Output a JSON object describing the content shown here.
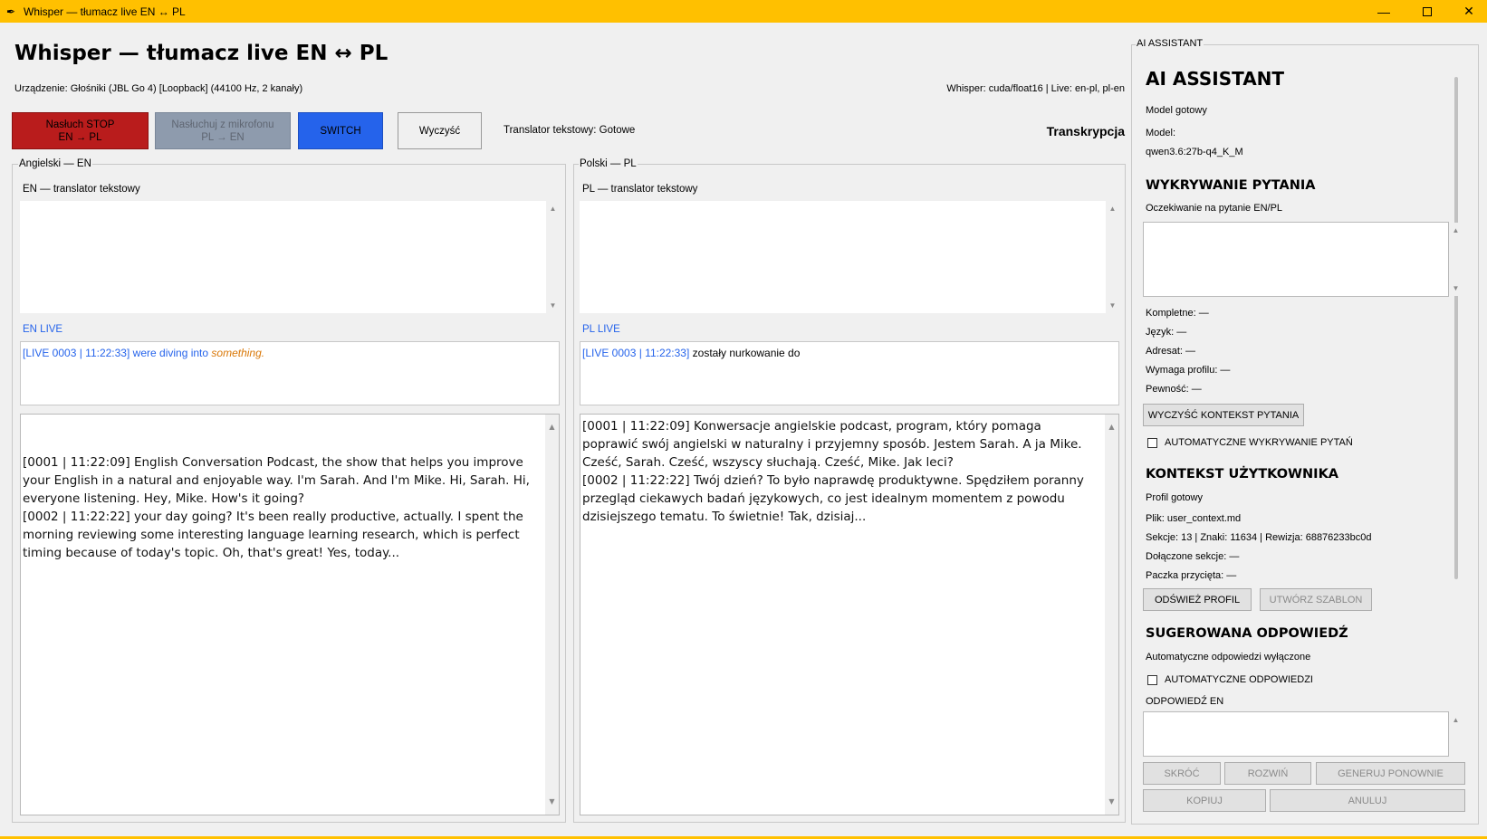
{
  "window": {
    "icon": "feather-icon",
    "title": "Whisper — tłumacz live EN ↔ PL",
    "controls": {
      "minimize": "—",
      "maximize": "",
      "close": "✕"
    }
  },
  "header": {
    "title": "Whisper — tłumacz live EN ↔ PL",
    "device": "Urządzenie: Głośniki (JBL Go 4) [Loopback] (44100 Hz, 2 kanały)",
    "whisper_info": "Whisper: cuda/float16 | Live: en-pl, pl-en"
  },
  "toolbar": {
    "stop_line1": "Nasłuch STOP",
    "stop_line2": "EN → PL",
    "mic_line1": "Nasłuchuj z mikrofonu",
    "mic_line2": "PL → EN",
    "switch": "SWITCH",
    "clear": "Wyczyść",
    "translator_status": "Translator tekstowy: Gotowe",
    "transcription_label": "Transkrypcja"
  },
  "colors": {
    "titlebar": "#ffc000",
    "stop": "#b91c1c",
    "mic_disabled": "#8e9bad",
    "switch": "#2563eb",
    "live_label": "#2563eb",
    "pending_word": "#d97706"
  },
  "english": {
    "group_label": "Angielski — EN",
    "translator_label": "EN — translator tekstowy",
    "translator_value": "",
    "live_label": "EN LIVE",
    "live_ts": "[LIVE 0003 | 11:22:33]",
    "live_text": "were diving into",
    "live_pending": "something.",
    "transcript": "[0001 | 11:22:09] English Conversation Podcast, the show that helps you improve your English in a natural and enjoyable way. I'm Sarah. And I'm Mike. Hi, Sarah. Hi, everyone listening. Hey, Mike. How's it going?\n[0002 | 11:22:22] your day going? It's been really productive, actually. I spent the morning reviewing some interesting language learning research, which is perfect timing because of today's topic. Oh, that's great! Yes, today..."
  },
  "polish": {
    "group_label": "Polski — PL",
    "translator_label": "PL — translator tekstowy",
    "translator_value": "",
    "live_label": "PL LIVE",
    "live_ts": "[LIVE 0003 | 11:22:33]",
    "live_text": "zostały nurkowanie do",
    "transcript": "[0001 | 11:22:09] Konwersacje angielskie podcast, program, który pomaga poprawić swój angielski w naturalny i przyjemny sposób. Jestem Sarah. A ja Mike. Cześć, Sarah. Cześć, wszyscy słuchają. Cześć, Mike. Jak leci?\n[0002 | 11:22:22] Twój dzień? To było naprawdę produktywne. Spędziłem poranny przegląd ciekawych badań językowych, co jest idealnym momentem z powodu dzisiejszego tematu. To świetnie! Tak, dzisiaj..."
  },
  "ai": {
    "frame_label": "AI ASSISTANT",
    "title": "AI ASSISTANT",
    "model_status": "Model gotowy",
    "model_label": "Model:",
    "model_name": "qwen3.6:27b-q4_K_M",
    "question_heading": "WYKRYWANIE PYTANIA",
    "question_status": "Oczekiwanie na pytanie EN/PL",
    "question_value": "",
    "complete": "Kompletne: —",
    "language": "Język: —",
    "addressee": "Adresat: —",
    "needs_profile": "Wymaga profilu: —",
    "confidence": "Pewność: —",
    "clear_context_button": "WYCZYŚĆ KONTEKST PYTANIA",
    "auto_detect_label": "AUTOMATYCZNE WYKRYWANIE PYTAŃ",
    "auto_detect_checked": false,
    "context_heading": "KONTEKST UŻYTKOWNIKA",
    "profile_status": "Profil gotowy",
    "file": "Plik: user_context.md",
    "stats": "Sekcje: 13 | Znaki: 11634 | Rewizja: 68876233bc0d",
    "attached": "Dołączone sekcje: —",
    "trimmed": "Paczka przycięta: —",
    "refresh_button": "ODŚWIEŻ PROFIL",
    "template_button": "UTWÓRZ SZABLON",
    "answer_heading": "SUGEROWANA ODPOWIEDŹ",
    "answer_status": "Automatyczne odpowiedzi wyłączone",
    "auto_answer_label": "AUTOMATYCZNE ODPOWIEDZI",
    "auto_answer_checked": false,
    "answer_en_label": "ODPOWIEDŹ EN",
    "answer_value": "",
    "shorten_button": "SKRÓĆ",
    "expand_button": "ROZWIŃ",
    "regenerate_button": "GENERUJ PONOWNIE",
    "copy_button": "KOPIUJ",
    "cancel_button": "ANULUJ"
  }
}
